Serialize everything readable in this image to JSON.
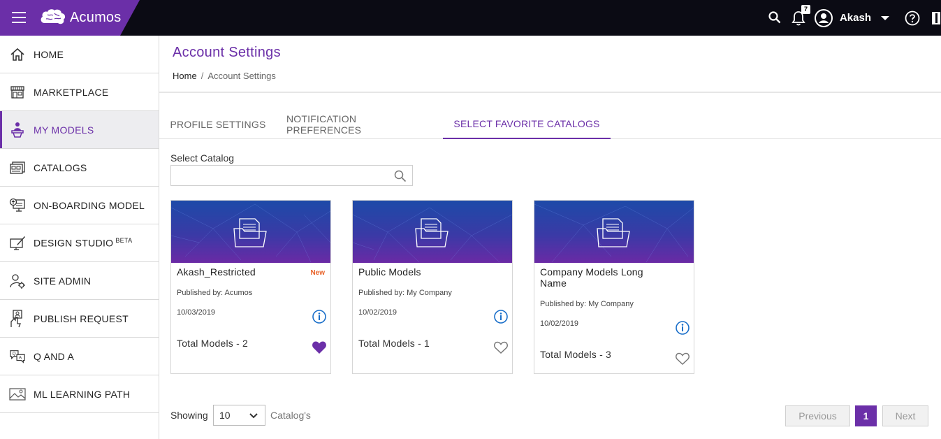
{
  "header": {
    "brand_name": "Acumos",
    "user_name": "Akash",
    "notification_count": "7",
    "icons": [
      "menu-icon",
      "search-icon",
      "bell-icon",
      "user-avatar-icon",
      "chevron-down-icon",
      "help-icon",
      "book-icon"
    ],
    "colors": {
      "bar": "#0b0b14",
      "brand": "#6b2fa8"
    }
  },
  "sidebar": {
    "items": [
      {
        "label": "HOME",
        "icon": "home-icon"
      },
      {
        "label": "MARKETPLACE",
        "icon": "store-icon"
      },
      {
        "label": "MY MODELS",
        "icon": "models-icon",
        "active": true
      },
      {
        "label": "CATALOGS",
        "icon": "catalog-icon"
      },
      {
        "label": "ON-BOARDING MODEL",
        "icon": "onboarding-icon"
      },
      {
        "label": "DESIGN STUDIO",
        "sup": "BETA",
        "icon": "design-studio-icon"
      },
      {
        "label": "SITE ADMIN",
        "icon": "site-admin-icon"
      },
      {
        "label": "PUBLISH REQUEST",
        "icon": "publish-icon"
      },
      {
        "label": "Q AND A",
        "icon": "qa-icon"
      },
      {
        "label": "ML LEARNING PATH",
        "icon": "learning-path-icon"
      }
    ]
  },
  "page": {
    "title": "Account Settings",
    "breadcrumb": {
      "home": "Home",
      "separator": "/",
      "current": "Account Settings"
    }
  },
  "tabs": [
    {
      "label": "PROFILE SETTINGS",
      "active": false
    },
    {
      "label": "NOTIFICATION PREFERENCES",
      "active": false
    },
    {
      "label": "SELECT FAVORITE CATALOGS",
      "active": true
    }
  ],
  "catalog_search": {
    "label": "Select Catalog",
    "value": "",
    "placeholder": ""
  },
  "cards": [
    {
      "title": "Akash_Restricted",
      "badge": "New",
      "publisher": "Published by: Acumos",
      "date": "10/03/2019",
      "total": "Total Models - 2",
      "favorite": true
    },
    {
      "title": "Public Models",
      "badge": "",
      "publisher": "Published by: My Company",
      "date": "10/02/2019",
      "total": "Total Models - 1",
      "favorite": false
    },
    {
      "title": "Company Models Long Name",
      "badge": "",
      "publisher": "Published by: My Company",
      "date": "10/02/2019",
      "total": "Total Models - 3",
      "favorite": false
    }
  ],
  "pagination": {
    "showing_label": "Showing",
    "page_size": "10",
    "page_size_unit": "Catalog's",
    "previous": "Previous",
    "current_page": "1",
    "next": "Next"
  }
}
